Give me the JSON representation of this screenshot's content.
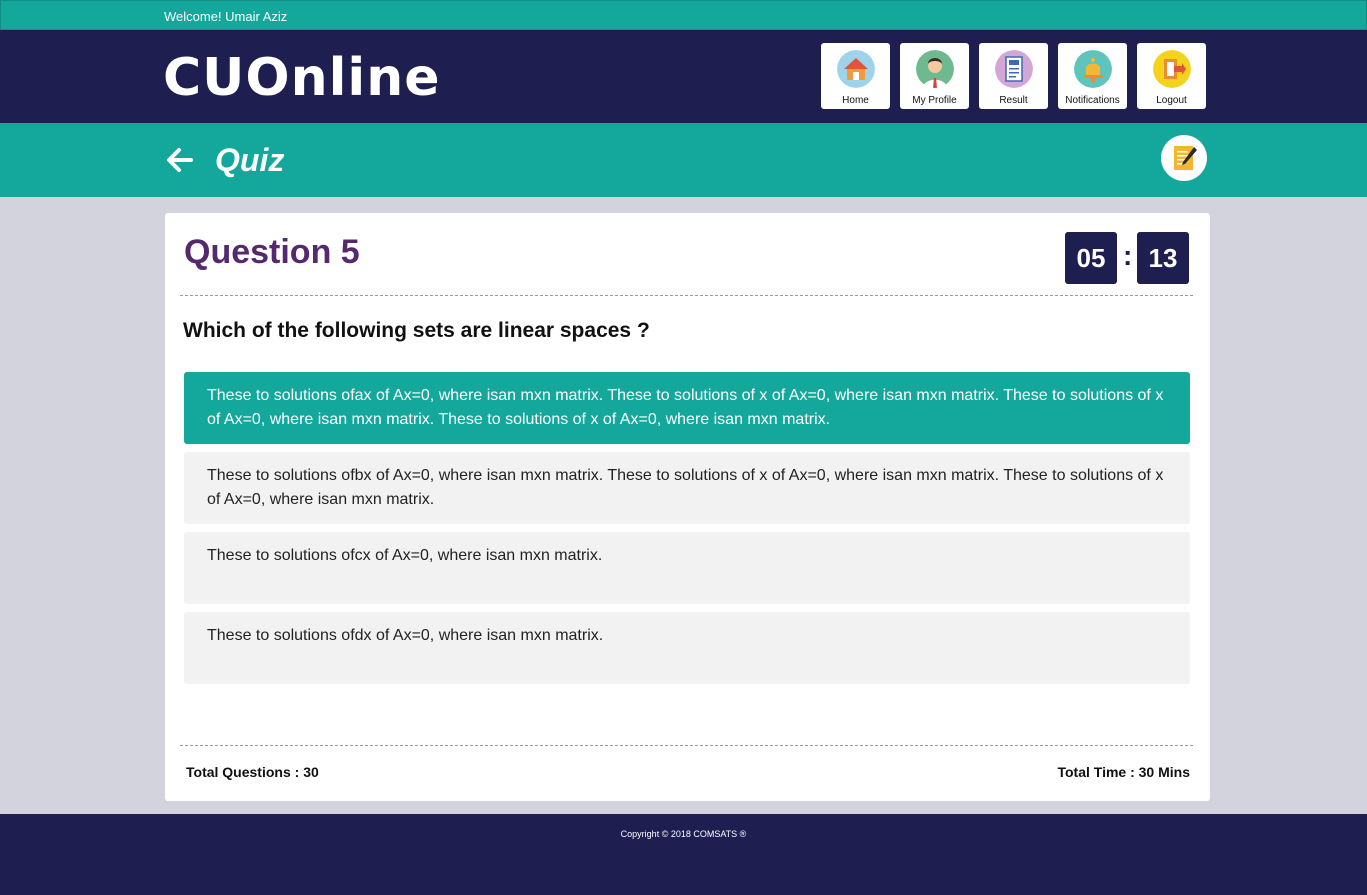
{
  "topbar": {
    "welcome": "Welcome! Umair Aziz"
  },
  "header": {
    "logo": "CUOnline",
    "nav": [
      {
        "label": "Home",
        "icon": "home-icon"
      },
      {
        "label": "My Profile",
        "icon": "profile-icon"
      },
      {
        "label": "Result",
        "icon": "result-icon"
      },
      {
        "label": "Notifications",
        "icon": "bell-icon"
      },
      {
        "label": "Logout",
        "icon": "logout-icon"
      }
    ]
  },
  "subheader": {
    "title": "Quiz",
    "back_icon": "arrow-left-icon",
    "action_icon": "notepad-icon"
  },
  "quiz": {
    "question_title": "Question 5",
    "timer": {
      "minutes": "05",
      "separator": ":",
      "seconds": "13"
    },
    "question_text": "Which of the following sets are linear spaces ?",
    "options": [
      {
        "text": "These to solutions ofax of Ax=0, where isan mxn matrix. These to solutions of x of Ax=0, where isan mxn matrix. These to solutions of x of Ax=0, where isan mxn matrix. These to solutions of x of Ax=0, where isan mxn matrix.",
        "selected": true
      },
      {
        "text": "These to solutions ofbx of Ax=0, where isan mxn matrix. These to solutions of x of Ax=0, where isan mxn matrix. These to solutions of x of Ax=0, where isan mxn matrix.",
        "selected": false
      },
      {
        "text": "These to solutions ofcx of Ax=0, where isan mxn matrix.",
        "selected": false
      },
      {
        "text": "These to solutions ofdx of Ax=0, where isan mxn matrix.",
        "selected": false
      }
    ],
    "total_questions": "Total Questions : 30",
    "total_time": "Total Time : 30 Mins"
  },
  "footer": {
    "copyright": "Copyright © 2018 COMSATS ®"
  },
  "colors": {
    "teal": "#14a89c",
    "navy": "#1f1e50",
    "purple": "#55296e",
    "background": "#d3d3dd"
  }
}
